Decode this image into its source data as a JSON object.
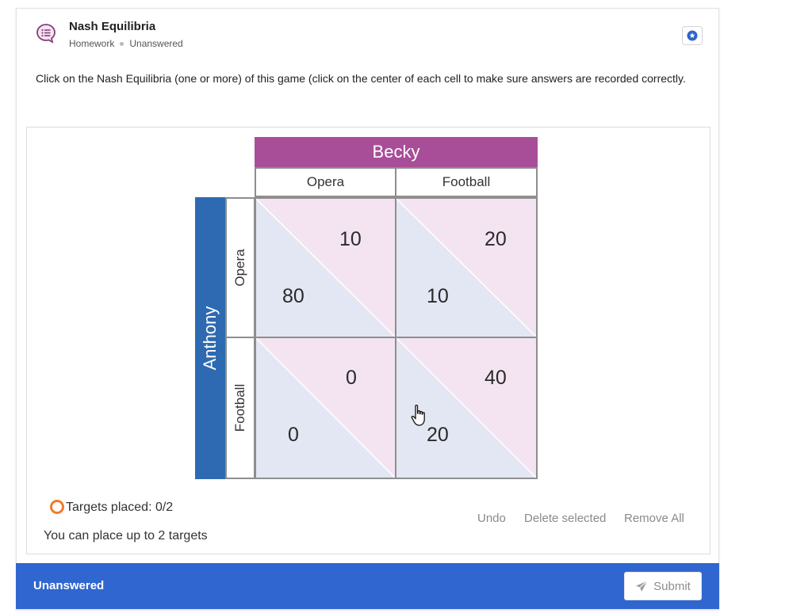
{
  "question": {
    "title": "Nash Equilibria",
    "type": "Homework",
    "status": "Unanswered",
    "prompt": "Click on the Nash Equilibria (one or more) of this game (click on the center of each cell to make sure answers are recorded correctly.",
    "icon": "chat-list-icon"
  },
  "game": {
    "column_player": "Becky",
    "row_player": "Anthony",
    "columns": [
      "Opera",
      "Football"
    ],
    "rows": [
      "Opera",
      "Football"
    ],
    "cells": [
      {
        "row": "Opera",
        "col": "Opera",
        "becky": "10",
        "anthony": "80"
      },
      {
        "row": "Opera",
        "col": "Football",
        "becky": "20",
        "anthony": "10"
      },
      {
        "row": "Football",
        "col": "Opera",
        "becky": "0",
        "anthony": "0"
      },
      {
        "row": "Football",
        "col": "Football",
        "becky": "40",
        "anthony": "20"
      }
    ],
    "colors": {
      "becky": "#a84e98",
      "anthony": "#2e6ab1",
      "cell_top": "#f4e4f1",
      "cell_bottom": "#e3e7f3"
    }
  },
  "targets": {
    "placed_text": "Targets placed: 0/2",
    "limit_text": "You can place up to 2 targets",
    "undo": "Undo",
    "delete_selected": "Delete selected",
    "remove_all": "Remove All"
  },
  "footer": {
    "status": "Unanswered",
    "submit": "Submit",
    "color": "#3066d0"
  }
}
